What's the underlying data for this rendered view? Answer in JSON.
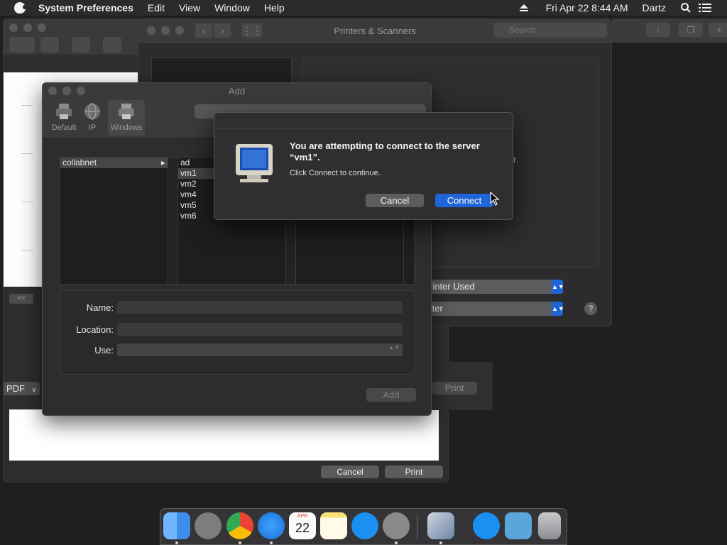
{
  "menubar": {
    "app_name": "System Preferences",
    "menus": [
      "Edit",
      "View",
      "Window",
      "Help"
    ],
    "datetime": "Fri Apr 22  8:44 AM",
    "user": "Dartz"
  },
  "doc_window": {
    "pdf_label": "PDF",
    "cancel_label": "Cancel",
    "print_label": "Print",
    "collapse_label": "<<"
  },
  "printers_window": {
    "title": "Printers & Scanners",
    "search_placeholder": "Search",
    "hint_fragment": "r.",
    "default_printer": "rinter Used",
    "default_paper": "tter",
    "print_label": "Print",
    "help_label": "?"
  },
  "add_window": {
    "title": "Add",
    "tabs": [
      "Default",
      "IP",
      "Windows"
    ],
    "workgroups": [
      "collabnet"
    ],
    "hosts": [
      "ad",
      "vm1",
      "vm2",
      "vm4",
      "vm5",
      "vm6"
    ],
    "selected_host": "vm1",
    "name_label": "Name:",
    "location_label": "Location:",
    "use_label": "Use:",
    "add_label": "Add"
  },
  "connect_dialog": {
    "title_line1": "You are attempting to connect to the server",
    "title_line2": "“vm1”.",
    "message": "Click Connect to continue.",
    "cancel_label": "Cancel",
    "connect_label": "Connect"
  },
  "dock": {
    "calendar_month": "APR",
    "calendar_day": "22"
  }
}
